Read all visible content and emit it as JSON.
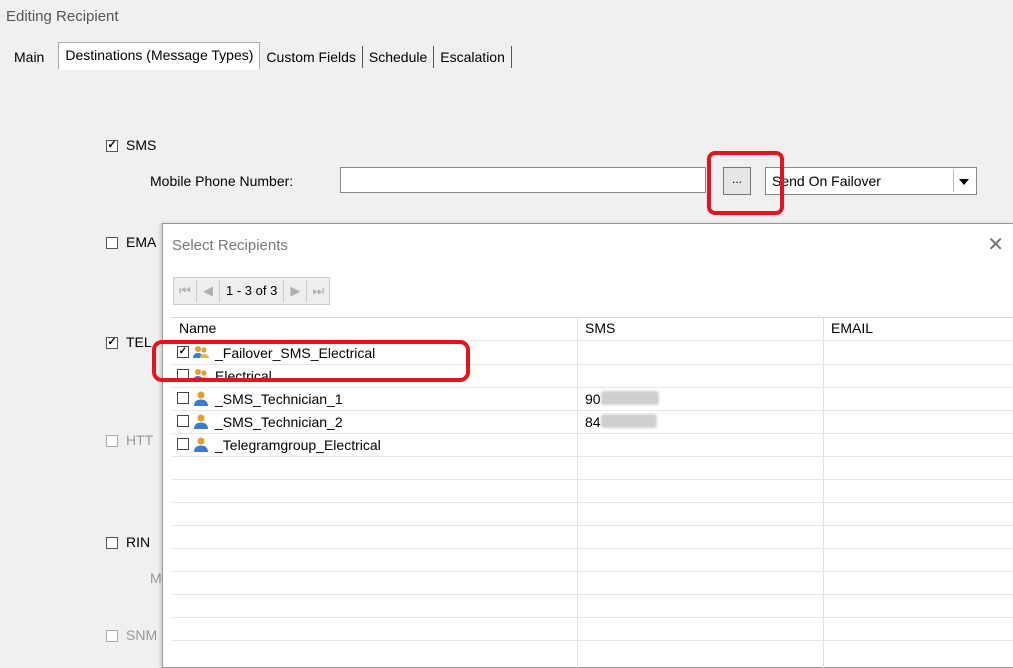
{
  "window": {
    "title": "Editing Recipient"
  },
  "tabs": [
    {
      "label": "Main"
    },
    {
      "label": "Destinations (Message Types)"
    },
    {
      "label": "Custom Fields"
    },
    {
      "label": "Schedule"
    },
    {
      "label": "Escalation"
    }
  ],
  "destinations": {
    "sms": {
      "label": "SMS",
      "checked": true
    },
    "mobile_label": "Mobile Phone Number:",
    "mobile_value": "",
    "browse_label": "...",
    "failover_value": "Send On Failover",
    "email": {
      "label": "EMA",
      "checked": false
    },
    "telegram": {
      "label": "TEL",
      "checked": true
    },
    "http": {
      "label": "HTT",
      "checked": false
    },
    "ring": {
      "label": "RIN",
      "checked": false
    },
    "ring_sub": "M",
    "snmp": {
      "label": "SNM",
      "checked": false
    }
  },
  "dialog": {
    "title": "Select Recipients",
    "close": "✕",
    "pager": {
      "info": "1 - 3 of 3",
      "first": "⏮",
      "prev": "◀",
      "next": "▶",
      "last": "⏭"
    },
    "columns": {
      "name": "Name",
      "sms": "SMS",
      "email": "EMAIL"
    },
    "rows": [
      {
        "name": "_Failover_SMS_Electrical",
        "sms": "",
        "checked": true,
        "icon": "group-icon"
      },
      {
        "name": "Electrical",
        "sms": "",
        "checked": false,
        "icon": "group-icon"
      },
      {
        "name": "_SMS_Technician_1",
        "sms": "90",
        "checked": false,
        "icon": "user-icon"
      },
      {
        "name": "_SMS_Technician_2",
        "sms": "84",
        "checked": false,
        "icon": "user-icon"
      },
      {
        "name": "_Telegramgroup_Electrical",
        "sms": "",
        "checked": false,
        "icon": "user-icon"
      }
    ]
  },
  "colors": {
    "annotation": "#e3141c",
    "background": "#f0f0f0"
  }
}
